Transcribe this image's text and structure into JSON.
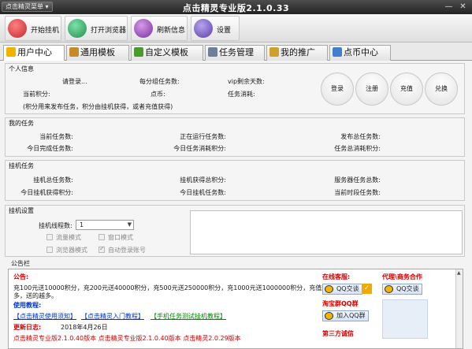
{
  "titlebar": {
    "menu_button": "点击精灵菜单 ▾",
    "title": "点击精灵专业版2.1.0.33",
    "min": "—",
    "close": "✕"
  },
  "toolbar": [
    {
      "name": "start-hang-button",
      "label": "开始挂机",
      "color": "#c2282e"
    },
    {
      "name": "open-browser-button",
      "label": "打开浏览器",
      "color": "#1d8f4c"
    },
    {
      "name": "refresh-info-button",
      "label": "刷新信息",
      "color": "#7a2da0"
    },
    {
      "name": "settings-button",
      "label": "设置",
      "color": "#5a3ea8"
    }
  ],
  "tabs": [
    {
      "label": "用户中心",
      "icon": "star-icon",
      "color": "#f2b200"
    },
    {
      "label": "通用模板",
      "icon": "tools-icon",
      "color": "#c58a2a"
    },
    {
      "label": "自定义模板",
      "icon": "leaf-icon",
      "color": "#4a9a2e"
    },
    {
      "label": "任务管理",
      "icon": "document-icon",
      "color": "#6d7f99"
    },
    {
      "label": "我的推广",
      "icon": "book-icon",
      "color": "#cfa12c"
    },
    {
      "label": "点币中心",
      "icon": "flag-icon",
      "color": "#3f7fcf"
    }
  ],
  "personal": {
    "title": "个人信息",
    "logging_in": "请登录...",
    "per_group_tasks": "每分组任务数:",
    "vip_days": "vip剩余天数:",
    "current_points": "当前积分:",
    "coins": "点币:",
    "task_consume": "任务消耗:",
    "note": "(积分用来发布任务，积分由挂机获得，或者充值获得)",
    "buttons": [
      "登录",
      "注册",
      "充值",
      "兑换"
    ]
  },
  "mytasks": {
    "title": "我的任务",
    "current_tasks": "当前任务数:",
    "running_tasks": "正在运行任务数:",
    "published_total": "发布总任务数:",
    "today_done": "今日完成任务数:",
    "today_consume": "今日任务消耗积分:",
    "total_consume": "任务总消耗积分:"
  },
  "hangtasks": {
    "title": "挂机任务",
    "hang_total": "挂机总任务数:",
    "hang_points_total": "挂机获得总积分:",
    "server_total": "服务器任务总数:",
    "today_points": "今日挂机获得积分:",
    "today_hang_tasks": "今日挂机任务数:",
    "current_period": "当前时段任务数:"
  },
  "hangsettings": {
    "title": "挂机设置",
    "threads_label": "挂机线程数:",
    "threads_value": "1",
    "options": [
      {
        "label": "流量模式",
        "checked": false
      },
      {
        "label": "窗口模式",
        "checked": false
      },
      {
        "label": "浏览器模式",
        "checked": false
      },
      {
        "label": "自动登录账号",
        "checked": true
      }
    ]
  },
  "notice": {
    "title": "公告栏",
    "heading": "公告:",
    "line1": "充100元送10000积分，充200元送40000积分，充500元送250000积分，充1000元送1000000积分，充值越",
    "line2": "多，送的越多。",
    "tutorial": "使用教程:",
    "links": [
      "【点击精灵使用须知】",
      "【点击精灵入门教程】",
      "【手机任务测试挂机教程】"
    ],
    "update_label": "更新日志:",
    "update_date": "2018年4月26日",
    "update_line": "点击精灵专业版2.1.0.40版本 点击精灵专业版2.1.0.40版本 点击精灵2.0.29版本",
    "service_title": "在线客服:",
    "agent_title": "代理\\商务合作",
    "qq_label": "QQ交谈",
    "qq_group": "淘宝群QQ群",
    "join_group": "加入QQ群",
    "third_party": "第三方诚信"
  }
}
